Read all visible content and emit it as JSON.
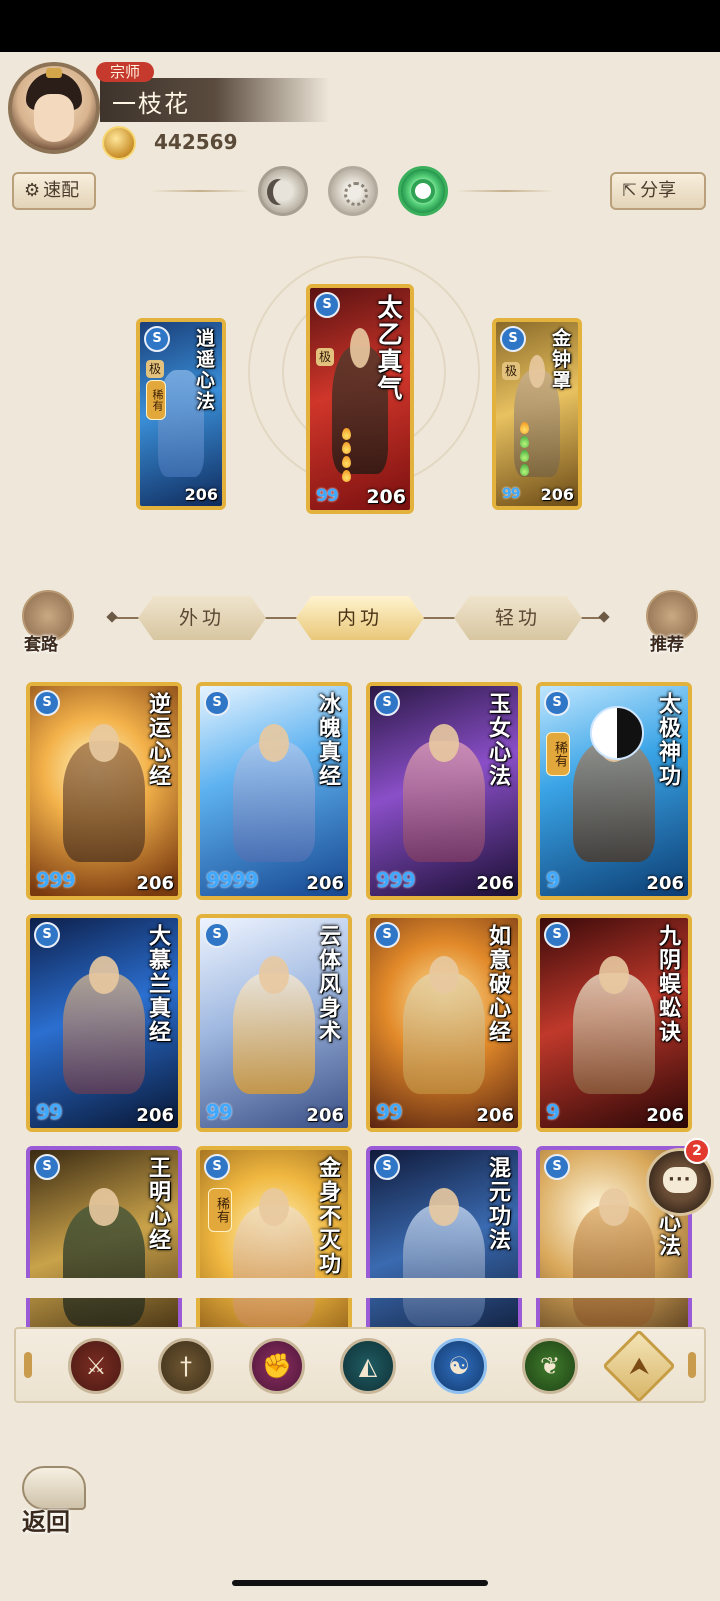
{
  "header": {
    "title_badge": "宗师",
    "player_name": "一枝花",
    "coins": "442569",
    "quick_label": "速配",
    "share_label": "分享"
  },
  "equipped": [
    {
      "name": "逍遥心法",
      "level": "206",
      "stars": "",
      "rare": "稀有",
      "grade": "极"
    },
    {
      "name": "太乙真气",
      "level": "206",
      "stars": "99",
      "rare": "",
      "grade": "极"
    },
    {
      "name": "金钟罩",
      "level": "206",
      "stars": "99",
      "rare": "",
      "grade": "极"
    }
  ],
  "tabs": {
    "left_label": "套路",
    "right_label": "推荐",
    "items": [
      "外功",
      "内功",
      "轻功"
    ],
    "active": "内功"
  },
  "skills": [
    {
      "name": "逆运心经",
      "level": "206",
      "stars": "999"
    },
    {
      "name": "冰魄真经",
      "level": "206",
      "stars": "9999"
    },
    {
      "name": "玉女心法",
      "level": "206",
      "stars": "999"
    },
    {
      "name": "太极神功",
      "level": "206",
      "stars": "9",
      "rare": "稀有"
    },
    {
      "name": "大慕兰真经",
      "level": "206",
      "stars": "99"
    },
    {
      "name": "云体风身术",
      "level": "206",
      "stars": "99"
    },
    {
      "name": "如意破心经",
      "level": "206",
      "stars": "99"
    },
    {
      "name": "九阴蜈蚣诀",
      "level": "206",
      "stars": "9"
    },
    {
      "name": "王明心经"
    },
    {
      "name": "金身不灭功",
      "rare": "稀有"
    },
    {
      "name": "混元功法"
    },
    {
      "name": "心法"
    }
  ],
  "chat": {
    "badge": "2"
  },
  "filters": [
    "sword-icon",
    "blade-icon",
    "fist-icon",
    "fan-icon",
    "yinyang-icon",
    "leaf-icon",
    "upgrade-icon"
  ],
  "back_label": "返回",
  "colors": {
    "gold_frame": "#e3b23c",
    "purple_frame": "#9b5bd6",
    "star_blue": "#3fa8ff",
    "badge_red": "#e23a2f"
  }
}
